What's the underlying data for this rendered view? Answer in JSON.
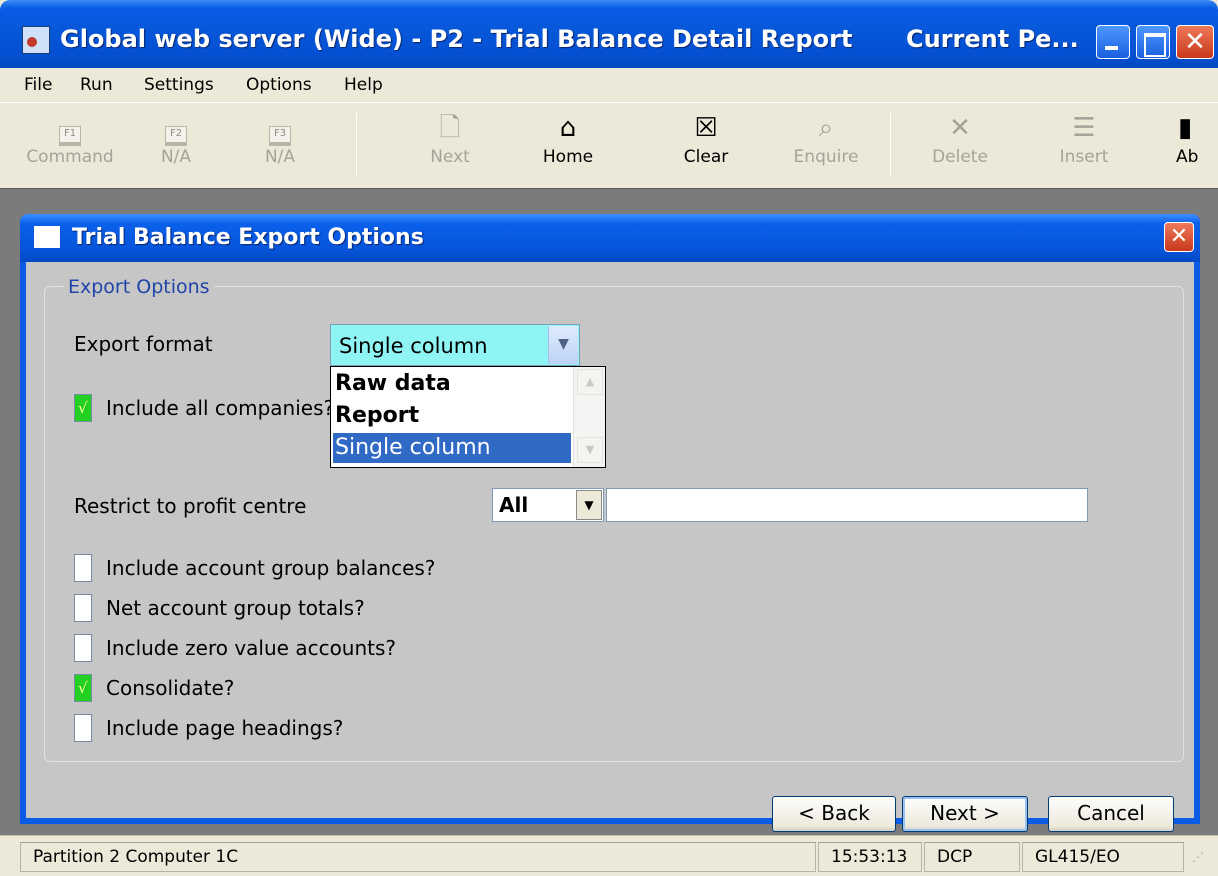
{
  "window": {
    "title": "Global web server (Wide) - P2 - Trial Balance Detail Report",
    "title_right": "Current Pe..."
  },
  "menu": [
    "File",
    "Run",
    "Settings",
    "Options",
    "Help"
  ],
  "toolbar": [
    {
      "label": "Command",
      "fkey": "F1",
      "enabled": false
    },
    {
      "label": "N/A",
      "fkey": "F2",
      "enabled": false
    },
    {
      "label": "N/A",
      "fkey": "F3",
      "enabled": false
    },
    {
      "label": "Next",
      "icon": "page-icon",
      "enabled": false
    },
    {
      "label": "Home",
      "icon": "home-icon",
      "enabled": true
    },
    {
      "label": "Clear",
      "icon": "clear-icon",
      "enabled": true
    },
    {
      "label": "Enquire",
      "icon": "magnifier-icon",
      "enabled": false
    },
    {
      "label": "Delete",
      "icon": "cross-icon",
      "enabled": false
    },
    {
      "label": "Insert",
      "icon": "insert-row-icon",
      "enabled": false
    },
    {
      "label": "Ab",
      "icon": "book-icon",
      "enabled": true
    }
  ],
  "dialog": {
    "title": "Trial Balance Export Options",
    "group_label": "Export Options",
    "export_format": {
      "label": "Export format",
      "value": "Single column",
      "options": [
        "Raw data",
        "Report",
        "Single column"
      ],
      "selected": "Single column"
    },
    "include_all_companies": {
      "label": "Include all companies?",
      "checked": true
    },
    "profit_centre": {
      "label": "Restrict to profit centre",
      "value": "All",
      "text": ""
    },
    "checkboxes": [
      {
        "label": "Include account group balances?",
        "checked": false
      },
      {
        "label": "Net account group totals?",
        "checked": false
      },
      {
        "label": "Include zero value accounts?",
        "checked": false
      },
      {
        "label": "Consolidate?",
        "checked": true
      },
      {
        "label": "Include page headings?",
        "checked": false
      }
    ],
    "buttons": {
      "back": "< Back",
      "next": "Next >",
      "cancel": "Cancel"
    }
  },
  "statusbar": {
    "partition": "Partition 2 Computer 1C",
    "time": "15:53:13",
    "user": "DCP",
    "program": "GL415/EO"
  }
}
